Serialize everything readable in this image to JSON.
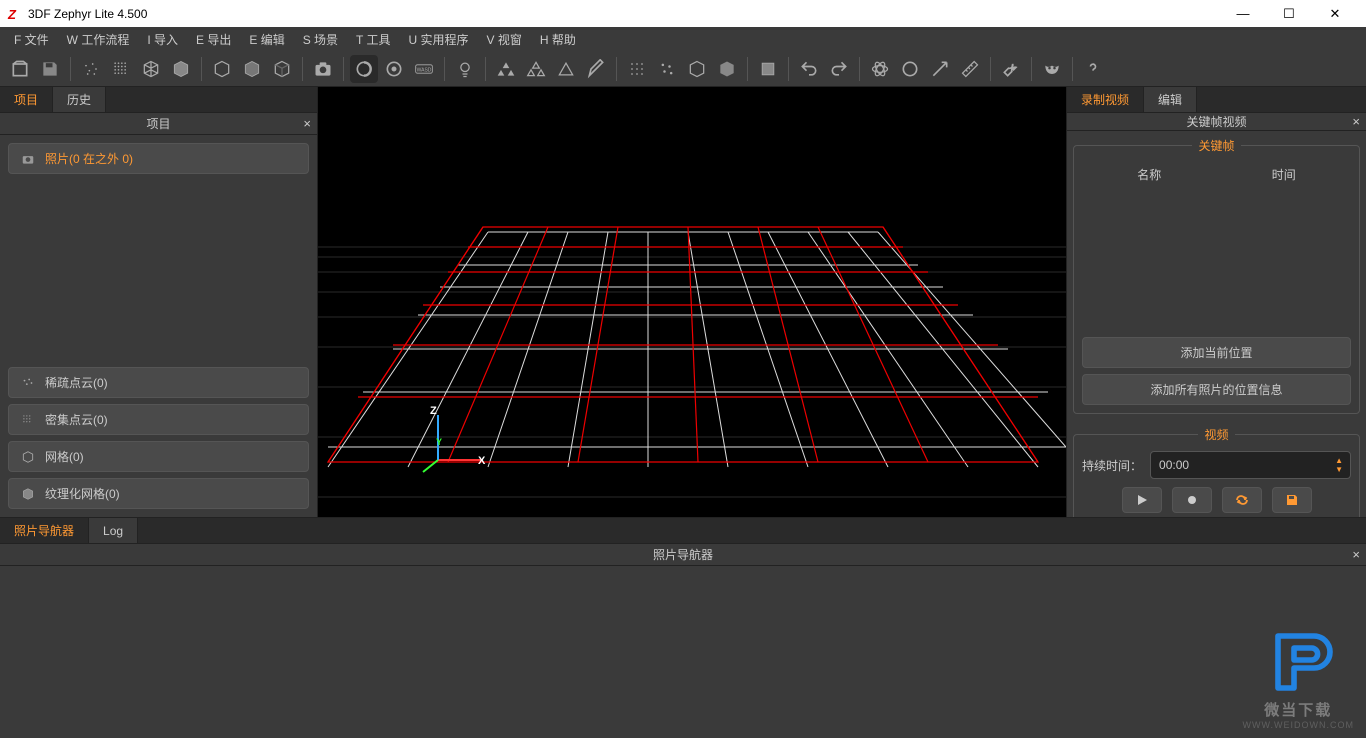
{
  "window": {
    "title": "3DF Zephyr Lite 4.500"
  },
  "menu": {
    "file": "F 文件",
    "workflow": "W 工作流程",
    "import": "I 导入",
    "export": "E 导出",
    "edit": "E 编辑",
    "scene": "S 场景",
    "tools": "T 工具",
    "utility": "U 实用程序",
    "view": "V 视窗",
    "help": "H 帮助"
  },
  "left": {
    "tab_project": "项目",
    "tab_history": "历史",
    "panel_title": "项目",
    "photos": "照片(0 在之外 0)",
    "sparse": "稀疏点云(0)",
    "dense": "密集点云(0)",
    "mesh": "网格(0)",
    "textured": "纹理化网格(0)"
  },
  "right": {
    "tab_record": "录制视频",
    "tab_edit": "编辑",
    "panel_title": "关键帧视频",
    "keyframe_legend": "关键帧",
    "col_name": "名称",
    "col_time": "时间",
    "btn_add_current": "添加当前位置",
    "btn_add_all": "添加所有照片的位置信息",
    "video_legend": "视频",
    "duration_label": "持续时间：",
    "time_value": "00:00"
  },
  "bottom": {
    "tab_nav": "照片导航器",
    "tab_log": "Log",
    "panel_title": "照片导航器"
  },
  "axes": {
    "x": "X",
    "y": "Y",
    "z": "Z"
  },
  "watermark": {
    "t1": "微当下载",
    "t2": "WWW.WEIDOWN.COM"
  }
}
